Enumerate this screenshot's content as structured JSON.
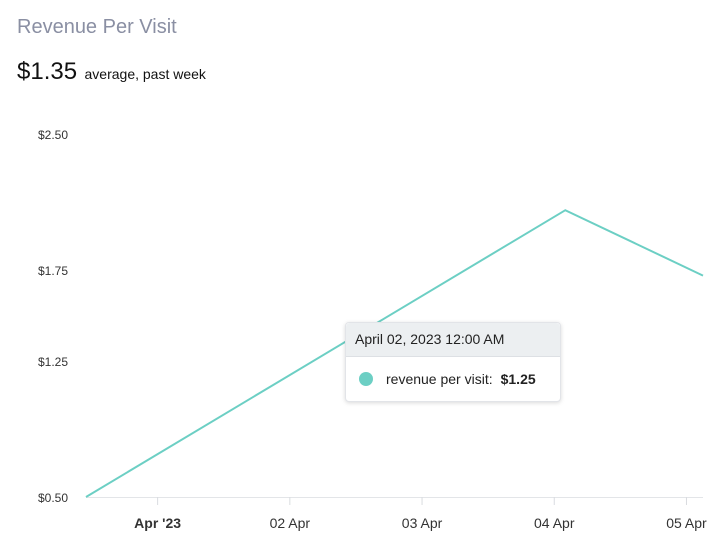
{
  "card": {
    "title": "Revenue Per Visit",
    "metric_value": "$1.35",
    "metric_caption": "average, past week"
  },
  "tooltip": {
    "header": "April 02, 2023 12:00 AM",
    "series_label": "revenue per visit:",
    "value": "$1.25"
  },
  "colors": {
    "series": "#6ccfc4",
    "title": "#8a8fa3",
    "axis_text": "#333333"
  },
  "chart_data": {
    "type": "line",
    "title": "",
    "xlabel": "",
    "ylabel": "",
    "ylim": [
      0.5,
      2.5
    ],
    "xlim": [
      "2023-03-31T11:00",
      "2023-04-05T03:00"
    ],
    "y_ticks": [
      {
        "value": 0.5,
        "label": "$0.50"
      },
      {
        "value": 1.25,
        "label": "$1.25"
      },
      {
        "value": 1.75,
        "label": "$1.75"
      },
      {
        "value": 2.5,
        "label": "$2.50"
      }
    ],
    "x_ticks": [
      {
        "value": "2023-04-01T00:00",
        "label": "Apr '23",
        "bold": true
      },
      {
        "value": "2023-04-02T00:00",
        "label": "02 Apr",
        "bold": false
      },
      {
        "value": "2023-04-03T00:00",
        "label": "03 Apr",
        "bold": false
      },
      {
        "value": "2023-04-04T00:00",
        "label": "04 Apr",
        "bold": false
      },
      {
        "value": "2023-04-05T00:00",
        "label": "05 Apr",
        "bold": false
      }
    ],
    "series": [
      {
        "name": "revenue per visit",
        "points": [
          {
            "x": "2023-03-31T11:00",
            "y": 0.5
          },
          {
            "x": "2023-04-04T02:00",
            "y": 2.08
          },
          {
            "x": "2023-04-05T03:00",
            "y": 1.72
          }
        ]
      }
    ],
    "grid": false,
    "legend": "none"
  }
}
